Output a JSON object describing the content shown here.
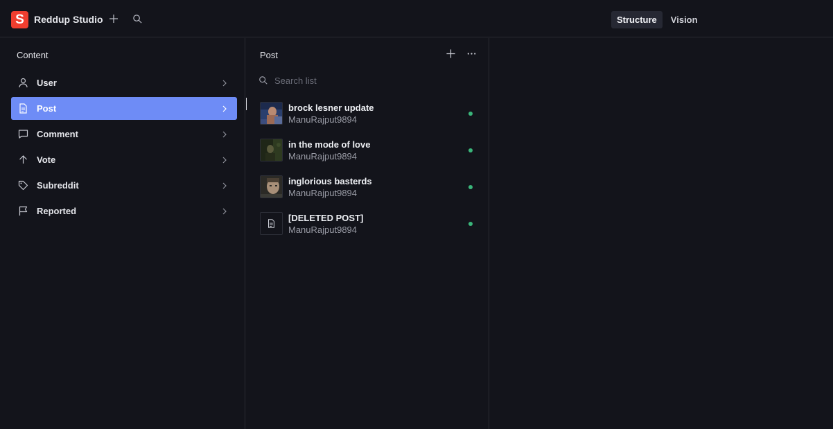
{
  "app": {
    "logo_letter": "S",
    "title": "Reddup Studio"
  },
  "topbar": {
    "tabs": [
      {
        "label": "Structure",
        "active": true
      },
      {
        "label": "Vision",
        "active": false
      }
    ]
  },
  "content_pane": {
    "title": "Content",
    "items": [
      {
        "label": "User",
        "icon": "user-icon"
      },
      {
        "label": "Post",
        "icon": "document-icon",
        "active": true
      },
      {
        "label": "Comment",
        "icon": "comment-icon"
      },
      {
        "label": "Vote",
        "icon": "arrow-up-icon"
      },
      {
        "label": "Subreddit",
        "icon": "tag-icon"
      },
      {
        "label": "Reported",
        "icon": "flag-icon"
      }
    ]
  },
  "post_pane": {
    "title": "Post",
    "search_placeholder": "Search list",
    "posts": [
      {
        "title": "brock lesner update",
        "author": "ManuRajput9894",
        "thumb": "photo"
      },
      {
        "title": "in the mode of love",
        "author": "ManuRajput9894",
        "thumb": "photo"
      },
      {
        "title": "inglorious basterds",
        "author": "ManuRajput9894",
        "thumb": "photo"
      },
      {
        "title": "[DELETED POST]",
        "author": "ManuRajput9894",
        "thumb": "document-icon"
      }
    ]
  },
  "colors": {
    "accent": "#6e8cf6",
    "brand": "#f03e2f",
    "status_published": "#3ab57a"
  }
}
